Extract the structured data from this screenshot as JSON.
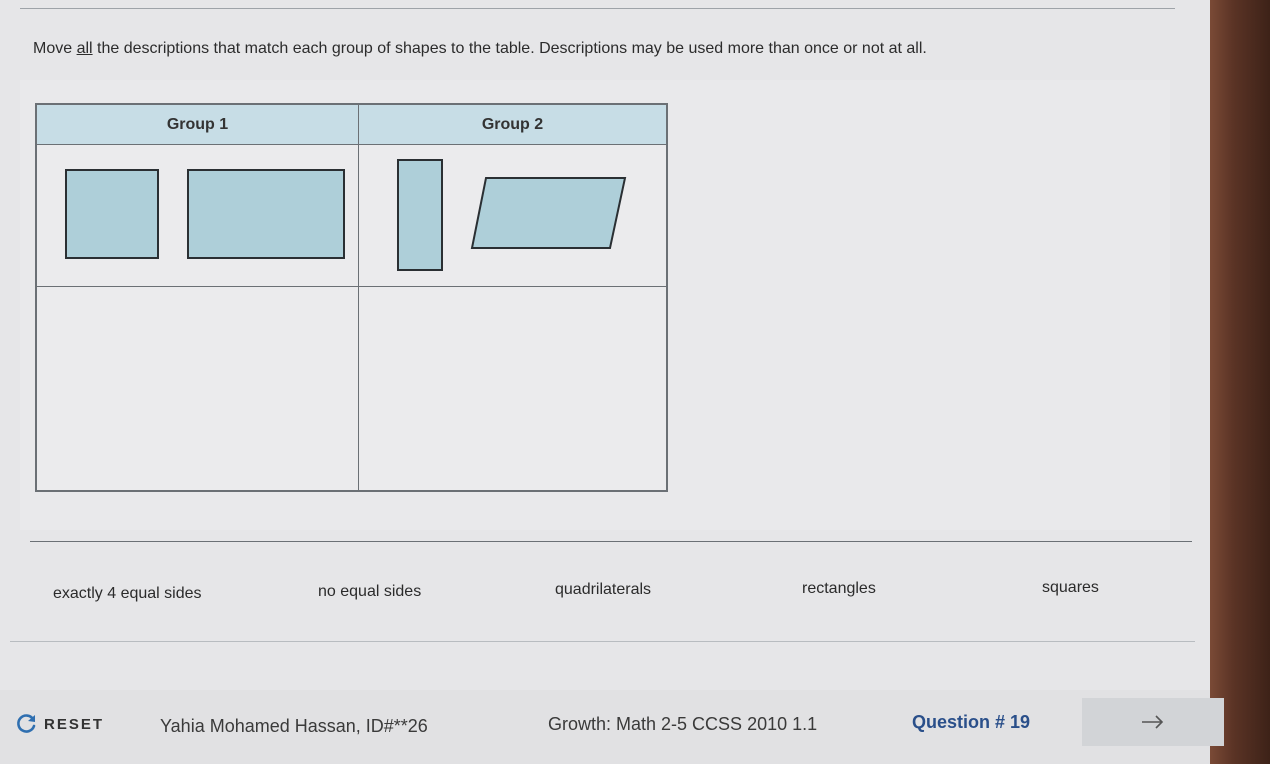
{
  "prompt": {
    "before": "Move ",
    "emph": "all",
    "after": " the descriptions that match each group of shapes to the table. Descriptions may be used more than once or not at all."
  },
  "table": {
    "group1_header": "Group 1",
    "group2_header": "Group 2"
  },
  "choices": [
    "exactly 4 equal sides",
    "no equal sides",
    "quadrilaterals",
    "rectangles",
    "squares"
  ],
  "footer": {
    "reset_label": "RESET",
    "student": "Yahia Mohamed Hassan, ID#**26",
    "assessment": "Growth: Math 2-5 CCSS 2010 1.1",
    "question": "Question # 19"
  },
  "colors": {
    "header_fill": "#c7dde6",
    "shape_fill": "#aecfd9",
    "question_text": "#2a4f8a"
  },
  "icons": {
    "reset": "refresh-icon",
    "next": "arrow-right-icon"
  }
}
